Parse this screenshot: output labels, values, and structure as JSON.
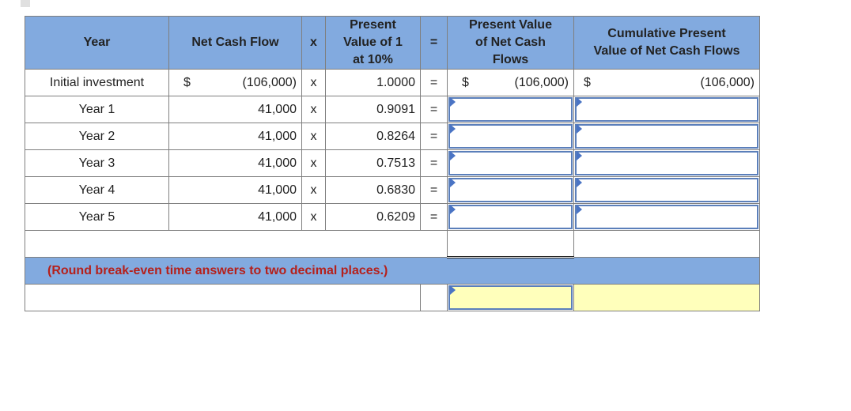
{
  "header": {
    "year": "Year",
    "net_cash_flow": "Net Cash Flow",
    "times": "x",
    "pv_of_1": [
      "Present",
      "Value of 1",
      "at 10%"
    ],
    "equals": "=",
    "pv_net_cash_flows": [
      "Present Value",
      "of Net Cash",
      "Flows"
    ],
    "cumulative": [
      "Cumulative Present",
      "Value of Net Cash Flows"
    ]
  },
  "rows": [
    {
      "year": "Initial investment",
      "currency": "$",
      "net_cash_flow": "(106,000)",
      "op1": "x",
      "pv_factor": "1.0000",
      "op2": "=",
      "pv_currency": "$",
      "pv_net": "(106,000)",
      "cum_currency": "$",
      "cumulative": "(106,000)"
    },
    {
      "year": "Year 1",
      "net_cash_flow": "41,000",
      "op1": "x",
      "pv_factor": "0.9091",
      "op2": "=",
      "pv_net": "",
      "cumulative": ""
    },
    {
      "year": "Year 2",
      "net_cash_flow": "41,000",
      "op1": "x",
      "pv_factor": "0.8264",
      "op2": "=",
      "pv_net": "",
      "cumulative": ""
    },
    {
      "year": "Year 3",
      "net_cash_flow": "41,000",
      "op1": "x",
      "pv_factor": "0.7513",
      "op2": "=",
      "pv_net": "",
      "cumulative": ""
    },
    {
      "year": "Year 4",
      "net_cash_flow": "41,000",
      "op1": "x",
      "pv_factor": "0.6830",
      "op2": "=",
      "pv_net": "",
      "cumulative": ""
    },
    {
      "year": "Year 5",
      "net_cash_flow": "41,000",
      "op1": "x",
      "pv_factor": "0.6209",
      "op2": "=",
      "pv_net": "",
      "cumulative": ""
    }
  ],
  "note": "(Round break-even time answers to two decimal places.)",
  "colors": {
    "header_bg": "#82aadf",
    "note_text": "#b5201b",
    "input_border": "#5b7fba",
    "answer_bg": "#ffffbb"
  }
}
